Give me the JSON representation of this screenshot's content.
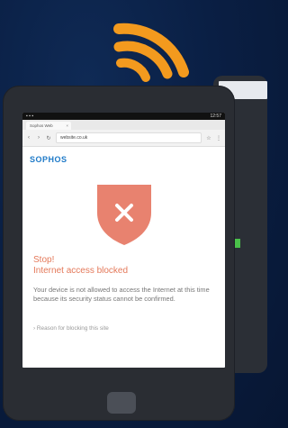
{
  "colors": {
    "background": "#0a1f44",
    "wifi": "#f39a1e",
    "phone": "#2a2d33",
    "shield": "#e8826f",
    "alert_text": "#e4795a",
    "brand": "#1e7ac8"
  },
  "icons": {
    "wifi": "wifi-icon",
    "shield": "shield-x-icon"
  },
  "browser": {
    "status_time": "12:57",
    "tab_title": "Sophos Web",
    "url": "website.co.uk"
  },
  "page": {
    "brand": "SOPHOS",
    "title_line1": "Stop!",
    "title_line2": "Internet access blocked",
    "message": "Your device is not allowed to access the Internet at this time because its security status cannot be confirmed.",
    "reason_link": "› Reason for blocking this site"
  }
}
